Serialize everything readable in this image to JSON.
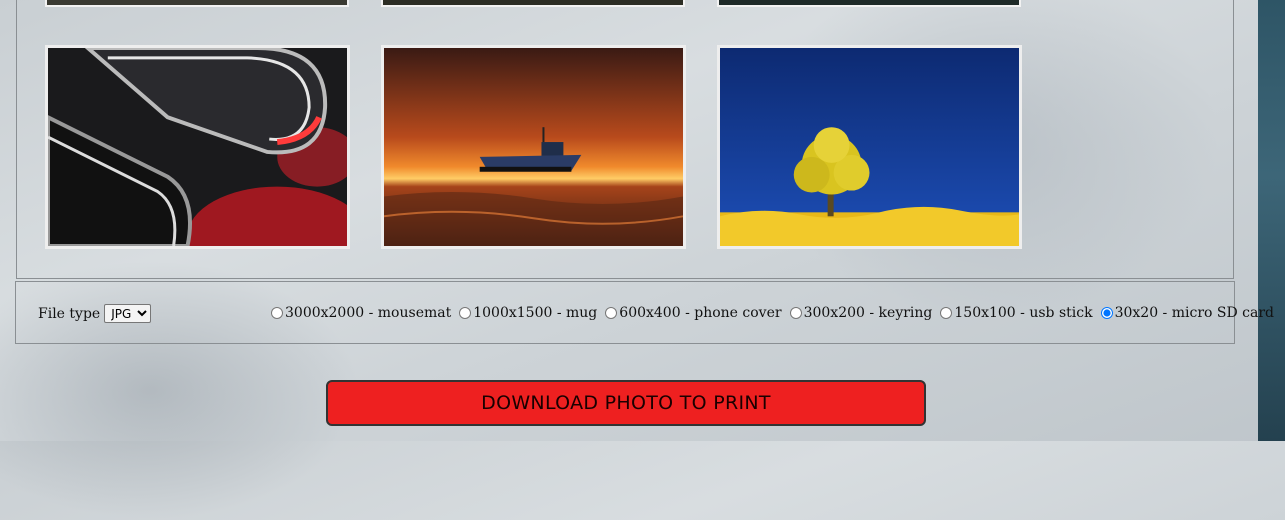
{
  "options": {
    "file_type_label": "File type",
    "file_type_selected": "JPG",
    "sizes": [
      {
        "label": "3000x2000 - mousemat",
        "selected": false
      },
      {
        "label": "1000x1500 - mug",
        "selected": false
      },
      {
        "label": "600x400 - phone cover",
        "selected": false
      },
      {
        "label": "300x200 - keyring",
        "selected": false
      },
      {
        "label": "150x100 - usb stick",
        "selected": false
      },
      {
        "label": "30x20 - micro SD card",
        "selected": true
      }
    ]
  },
  "download": {
    "label": "DOWNLOAD PHOTO TO PRINT"
  },
  "colors": {
    "button": "#ee2020",
    "accent_strip": "#2e5566"
  }
}
